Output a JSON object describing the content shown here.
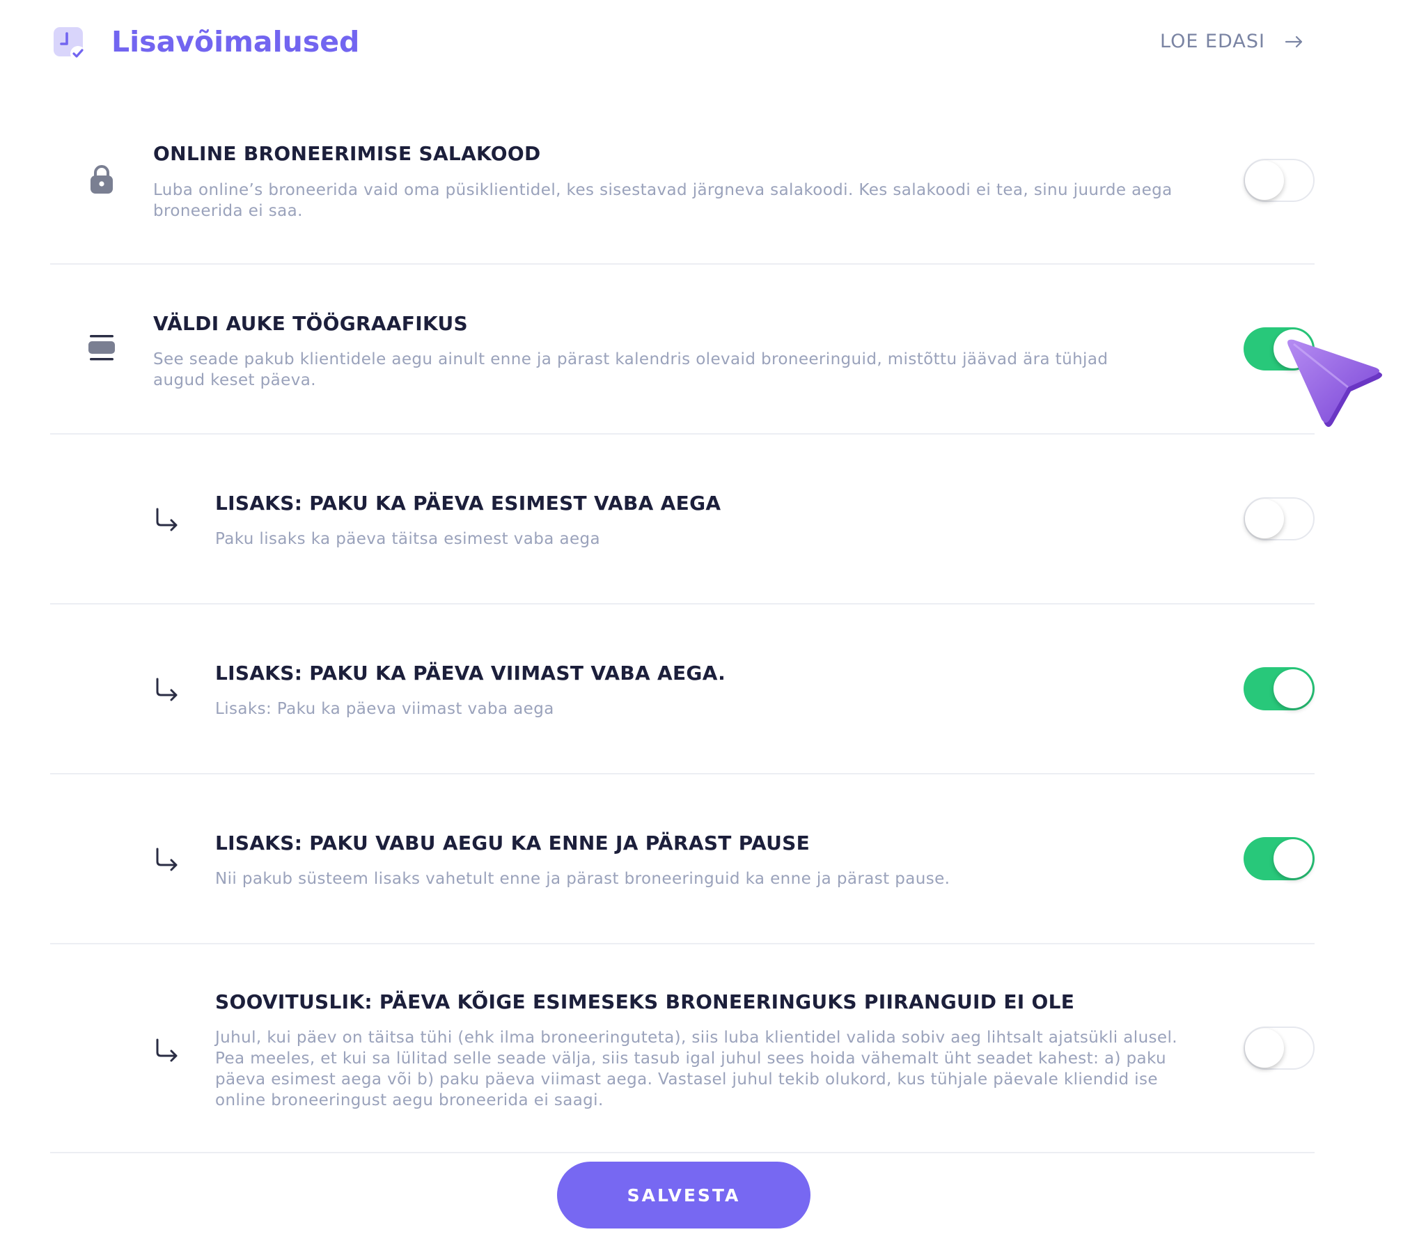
{
  "header": {
    "title": "Lisavõimalused",
    "read_more_label": "LOE EDASI"
  },
  "settings": [
    {
      "title": "ONLINE BRONEERIMISE SALAKOOD",
      "description": "Luba online’s broneerida vaid oma püsiklientidel, kes sisestavad järgneva salakoodi. Kes salakoodi ei tea, sinu juurde aega broneerida ei saa.",
      "icon": "lock-icon",
      "enabled": false
    },
    {
      "title": "VÄLDI AUKE TÖÖGRAAFIKUS",
      "description": "See seade pakub klientidele aegu ainult enne ja pärast kalendris olevaid broneeringuid, mistõttu jäävad ära tühjad augud keset päeva.",
      "icon": "schedule-gap-icon",
      "enabled": true
    },
    {
      "title": "LISAKS: PAKU KA PÄEVA ESIMEST VABA AEGA",
      "description": "Paku lisaks ka päeva täitsa esimest vaba aega",
      "icon": "sub-arrow-icon",
      "enabled": false
    },
    {
      "title": "LISAKS: PAKU KA PÄEVA VIIMAST VABA AEGA.",
      "description": "Lisaks: Paku ka päeva viimast vaba aega",
      "icon": "sub-arrow-icon",
      "enabled": true
    },
    {
      "title": "LISAKS: PAKU VABU AEGU KA ENNE JA PÄRAST PAUSE",
      "description": "Nii pakub süsteem lisaks vahetult enne ja pärast broneeringuid ka enne ja pärast pause.",
      "icon": "sub-arrow-icon",
      "enabled": true
    },
    {
      "title": "SOOVITUSLIK: PÄEVA KÕIGE ESIMESEKS BRONEERINGUKS PIIRANGUID EI OLE",
      "description": "Juhul, kui päev on täitsa tühi (ehk ilma broneeringuteta), siis luba klientidel valida sobiv aeg lihtsalt ajatsükli alusel. Pea meeles, et kui sa lülitad selle seade välja, siis tasub igal juhul sees hoida vähemalt üht seadet kahest: a) paku päeva esimest aega või b) paku päeva viimast aega. Vastasel juhul tekib olukord, kus tühjale päevale kliendid ise online broneeringust aegu broneerida ei saagi.",
      "icon": "sub-arrow-icon",
      "enabled": false
    }
  ],
  "save_label": "SALVESTA",
  "colors": {
    "accent": "#7265f0",
    "toggle_on": "#28c87a",
    "title_text": "#1c1f3b",
    "muted_text": "#9aa2bb"
  }
}
